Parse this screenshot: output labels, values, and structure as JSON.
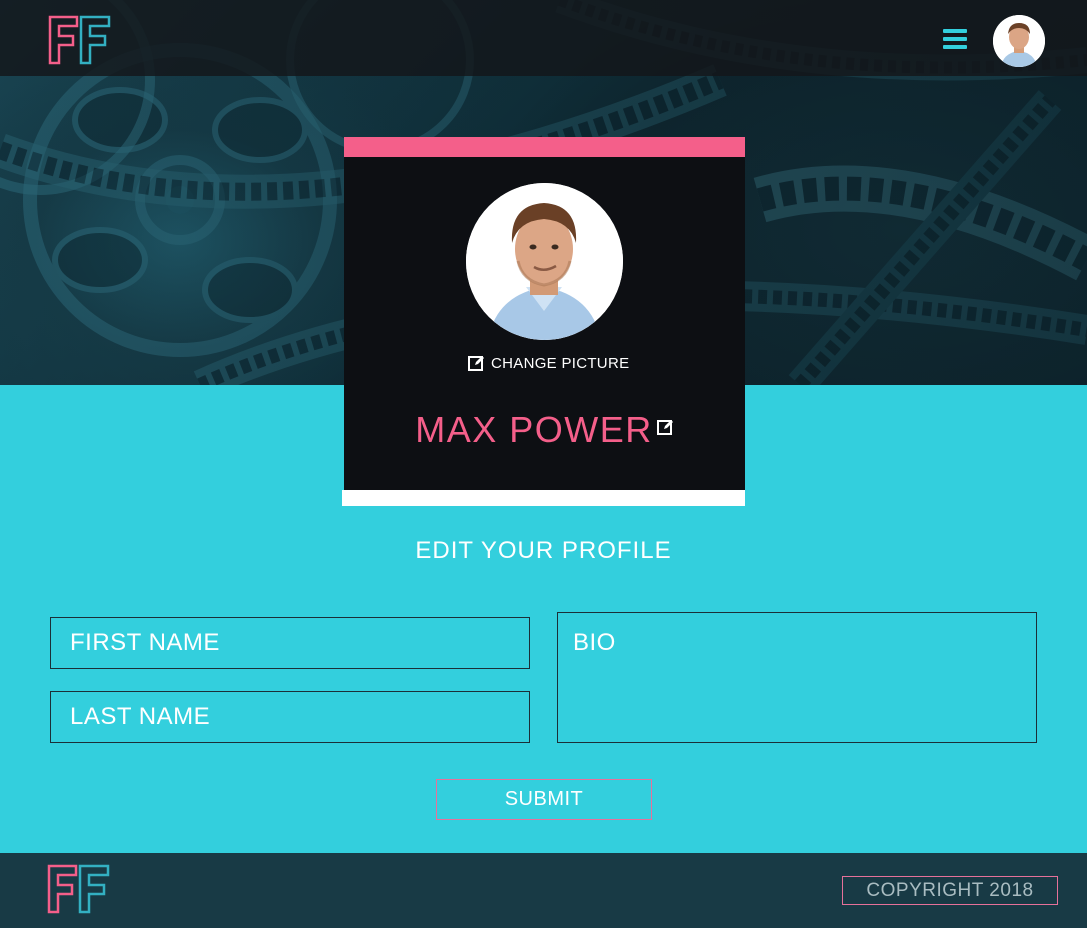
{
  "brand": {
    "logo_text": "FF",
    "colors": {
      "pink": "#f45f8a",
      "cyan": "#33cfdd",
      "dark": "#0d0f13",
      "footer": "#183a45"
    }
  },
  "nav": {
    "menu_icon": "hamburger-menu-icon",
    "avatar_icon": "user-avatar"
  },
  "profile": {
    "change_picture_label": "CHANGE PICTURE",
    "change_picture_icon": "edit-icon",
    "name": "MAX POWER",
    "name_edit_icon": "edit-icon"
  },
  "form": {
    "title": "EDIT YOUR PROFILE",
    "first_name_placeholder": "FIRST NAME",
    "last_name_placeholder": "LAST NAME",
    "bio_placeholder": "BIO",
    "submit_label": "SUBMIT"
  },
  "footer": {
    "copyright": "COPYRIGHT 2018"
  }
}
